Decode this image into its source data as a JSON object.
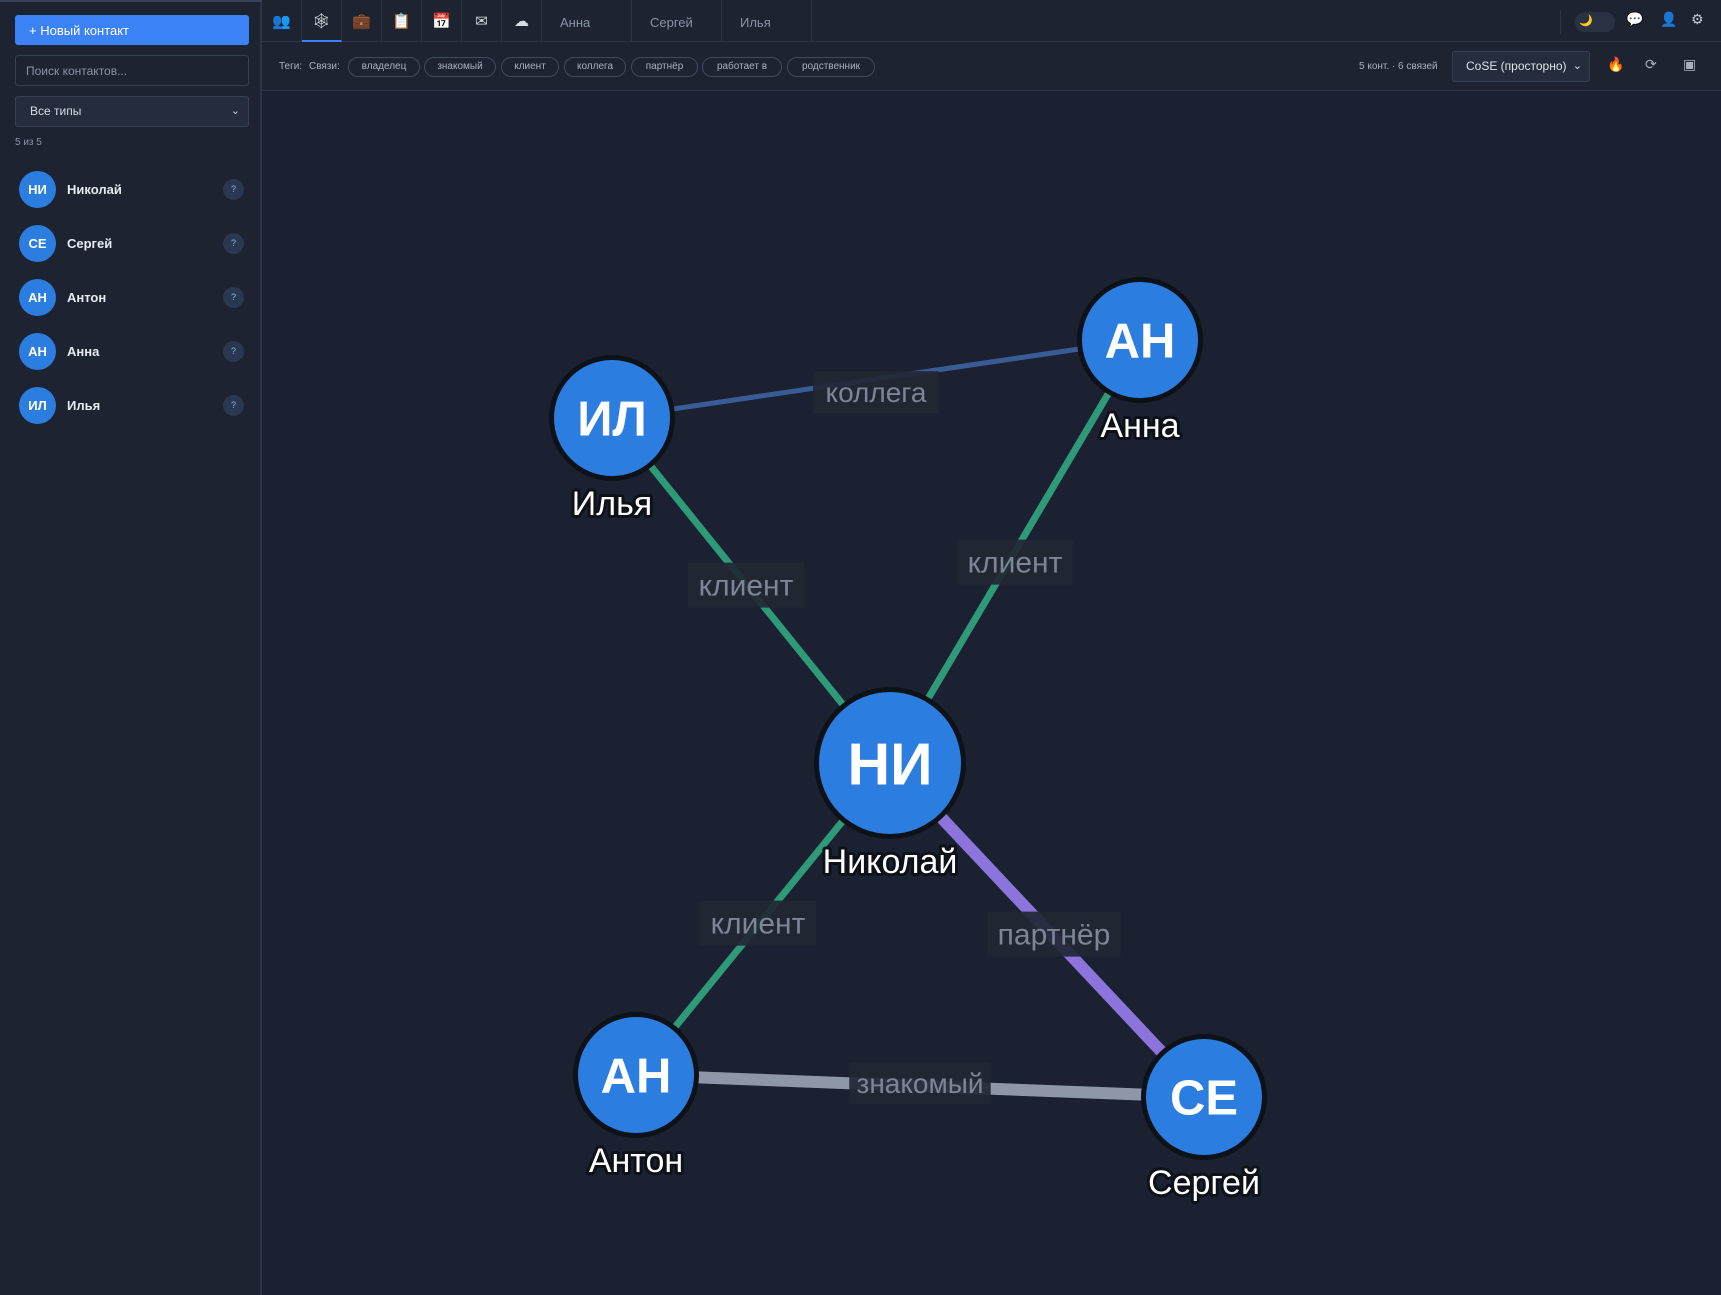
{
  "sidebar": {
    "new_contact": "+ Новый контакт",
    "search_placeholder": "Поиск контактов...",
    "type_filter": "Все типы",
    "count": "5 из 5",
    "contacts": [
      {
        "initials": "НИ",
        "name": "Николай",
        "badge": "?"
      },
      {
        "initials": "СЕ",
        "name": "Сергей",
        "badge": "?"
      },
      {
        "initials": "АН",
        "name": "Антон",
        "badge": "?"
      },
      {
        "initials": "АН",
        "name": "Анна",
        "badge": "?"
      },
      {
        "initials": "ИЛ",
        "name": "Илья",
        "badge": "?"
      }
    ]
  },
  "toolbar": {
    "icons": [
      "contacts-icon",
      "network-icon",
      "briefcase-icon",
      "clipboard-icon",
      "calendar-icon",
      "mail-icon",
      "cloud-icon"
    ],
    "tabs": [
      "Анна",
      "Сергей",
      "Илья"
    ],
    "right_icons": [
      "moon-icon",
      "chat-icon",
      "user-icon",
      "gear-icon"
    ]
  },
  "filters": {
    "tags_label": "Теги:",
    "links_label": "Связи:",
    "chips": [
      "владелец",
      "знакомый",
      "клиент",
      "коллега",
      "партнёр",
      "работает в",
      "родственник"
    ],
    "stats": "5 конт. · 6 связей",
    "layout": "CoSE (просторно)"
  },
  "colors": {
    "node": "#2b7de0",
    "client": "#2e9a7a",
    "colleague": "#3a5c96",
    "partner": "#8b75dc",
    "acquaintance": "#8d97a8"
  },
  "graph": {
    "nodes": [
      {
        "id": "il",
        "initials": "ИЛ",
        "name": "Илья"
      },
      {
        "id": "an1",
        "initials": "АН",
        "name": "Анна"
      },
      {
        "id": "ni",
        "initials": "НИ",
        "name": "Николай"
      },
      {
        "id": "an2",
        "initials": "АН",
        "name": "Антон"
      },
      {
        "id": "se",
        "initials": "СЕ",
        "name": "Сергей"
      }
    ],
    "edges": [
      {
        "source": "il",
        "target": "an1",
        "label": "коллега",
        "kind": "colleague"
      },
      {
        "source": "il",
        "target": "ni",
        "label": "клиент",
        "kind": "client"
      },
      {
        "source": "an1",
        "target": "ni",
        "label": "клиент",
        "kind": "client"
      },
      {
        "source": "ni",
        "target": "an2",
        "label": "клиент",
        "kind": "client"
      },
      {
        "source": "ni",
        "target": "se",
        "label": "партнёр",
        "kind": "partner"
      },
      {
        "source": "an2",
        "target": "se",
        "label": "знакомый",
        "kind": "acquaintance"
      }
    ]
  }
}
